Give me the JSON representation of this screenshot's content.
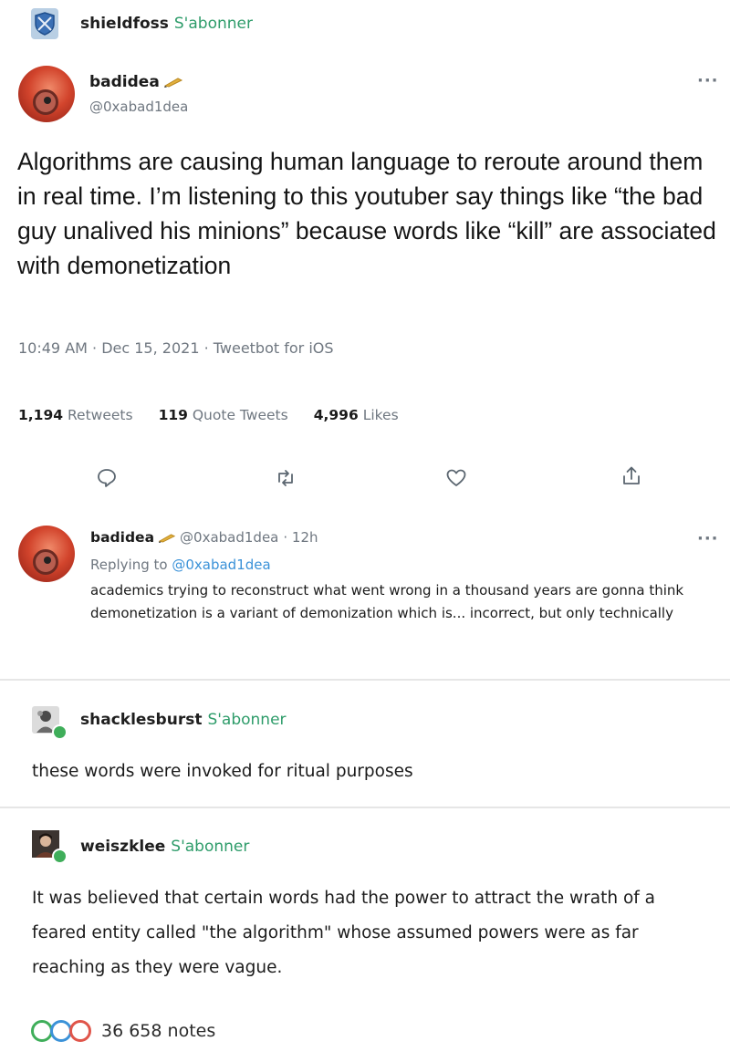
{
  "top_post": {
    "username": "shieldfoss",
    "follow_label": "S'abonner"
  },
  "tweet": {
    "name": "badidea",
    "handle": "@0xabad1dea",
    "body": "Algorithms are causing human language to reroute around them in real time. I’m listening to this youtuber say things like “the bad guy unalived his minions” because words like “kill” are associated with demonetization",
    "meta": "10:49 AM · Dec 15, 2021 · Tweetbot for iOS",
    "stats": [
      {
        "count": "1,194",
        "label": "Retweets"
      },
      {
        "count": "119",
        "label": "Quote Tweets"
      },
      {
        "count": "4,996",
        "label": "Likes"
      }
    ],
    "more_icon": "more-dots-icon",
    "actions": [
      "reply-icon",
      "retweet-icon",
      "like-icon",
      "share-icon"
    ]
  },
  "reply": {
    "name": "badidea",
    "handle": "@0xabad1dea",
    "time": "· 12h",
    "replying_prefix": "Replying to",
    "replying_handle": "@0xabad1dea",
    "body": "academics trying to reconstruct what went wrong in a thousand years are gonna think demonetization is a variant of demonization which is... incorrect, but only technically"
  },
  "reblog1": {
    "username": "shacklesburst",
    "follow_label": "S'abonner",
    "text": "these words were invoked for ritual purposes"
  },
  "reblog2": {
    "username": "weiszklee",
    "follow_label": "S'abonner",
    "text": "It was believed that certain words had the power to attract the wrath of a feared entity called \"the algorithm\" whose assumed powers were as far reaching as they were vague."
  },
  "notes": {
    "count_label": "36 658 notes"
  },
  "colors": {
    "follow_green": "#2e9c6a",
    "link_blue": "#3b92d8",
    "note_colors": [
      "#3fae5a",
      "#3b92d8",
      "#e0554a"
    ]
  }
}
